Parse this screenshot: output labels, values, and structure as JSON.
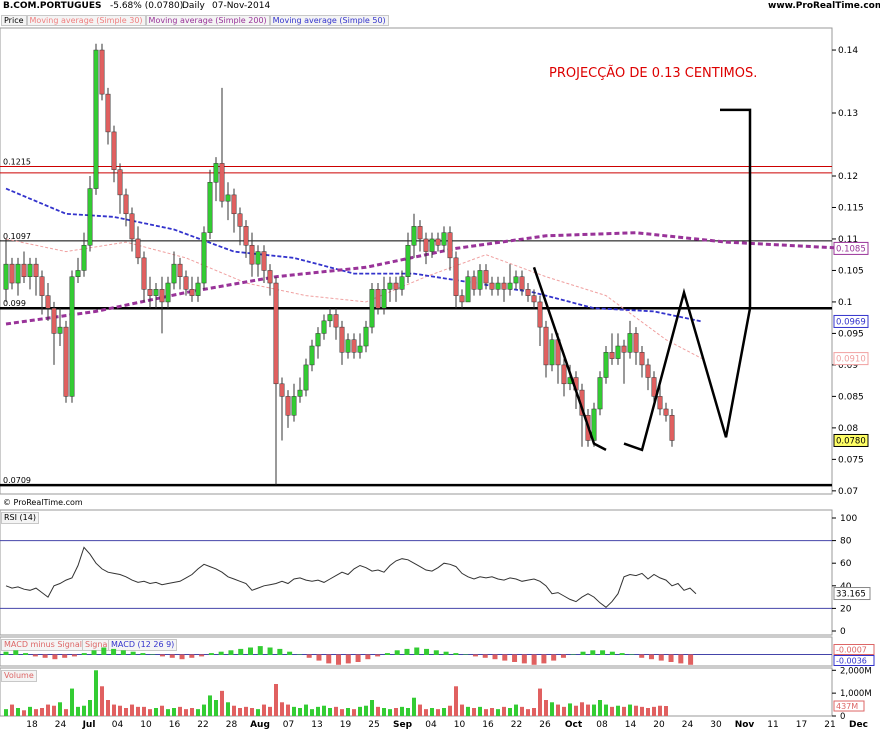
{
  "header": {
    "symbol": "B.COM.PORTUGUES",
    "change": "-5.68% (0.0780)",
    "period": "Daily",
    "date": "07-Nov-2014",
    "site": "www.ProRealTime.com"
  },
  "legend": {
    "price": "Price",
    "ma30": "Moving average (Simple 30)",
    "ma200": "Moving average (Simple 200)",
    "ma50": "Moving average (Simple 50)"
  },
  "copyright": "© ProRealTime.com",
  "annotation": "PROJECÇÃO DE 0.13 CENTIMOS.",
  "colors": {
    "up": "#33cc33",
    "down": "#e06060",
    "ma200": "#993399",
    "ma50": "#3333cc",
    "ma30": "#f0a0a0",
    "hline_red": "#cc0000",
    "annotation": "#dd0000"
  },
  "chart_data": [
    {
      "type": "candlestick",
      "title": "Price",
      "ylim": [
        0.0695,
        0.1435
      ],
      "y_ticks": [
        "0.14",
        "0.13",
        "0.12",
        "0.115",
        "0.11",
        "0.105",
        "0.1",
        "0.095",
        "0.09",
        "0.085",
        "0.08",
        "0.075",
        "0.07"
      ],
      "x_ticks": [
        "18",
        "24",
        "Jul",
        "04",
        "10",
        "16",
        "22",
        "28",
        "Aug",
        "07",
        "13",
        "19",
        "25",
        "Sep",
        "04",
        "10",
        "16",
        "22",
        "26",
        "Oct",
        "08",
        "14",
        "20",
        "24",
        "30",
        "Nov",
        "11",
        "17",
        "21",
        "Dec"
      ],
      "hlines": [
        {
          "value": 0.1215,
          "label": "0.1215",
          "color": "red"
        },
        {
          "value": 0.1205,
          "label": "",
          "color": "red"
        },
        {
          "value": 0.1097,
          "label": "0.1097",
          "color": "black"
        },
        {
          "value": 0.099,
          "label": "0.099",
          "color": "black"
        },
        {
          "value": 0.0709,
          "label": "0.0709",
          "color": "black"
        }
      ],
      "value_tags": [
        {
          "value": 0.1085,
          "label": "0.1085",
          "series": "Moving average (Simple 200)"
        },
        {
          "value": 0.0969,
          "label": "0.0969",
          "series": "Moving average (Simple 50)"
        },
        {
          "value": 0.091,
          "label": "0.0910",
          "series": "Moving average (Simple 30)"
        },
        {
          "value": 0.078,
          "label": "0.0780",
          "series": "Price"
        }
      ],
      "candles": [
        [
          0.102,
          0.106,
          0.11,
          0.1
        ],
        [
          0.106,
          0.103,
          0.107,
          0.102
        ],
        [
          0.103,
          0.106,
          0.107,
          0.101
        ],
        [
          0.106,
          0.104,
          0.108,
          0.103
        ],
        [
          0.104,
          0.106,
          0.107,
          0.102
        ],
        [
          0.106,
          0.104,
          0.107,
          0.101
        ],
        [
          0.104,
          0.101,
          0.105,
          0.098
        ],
        [
          0.101,
          0.099,
          0.103,
          0.097
        ],
        [
          0.099,
          0.095,
          0.1,
          0.09
        ],
        [
          0.095,
          0.096,
          0.099,
          0.093
        ],
        [
          0.096,
          0.085,
          0.097,
          0.084
        ],
        [
          0.085,
          0.104,
          0.105,
          0.084
        ],
        [
          0.104,
          0.105,
          0.107,
          0.103
        ],
        [
          0.105,
          0.109,
          0.111,
          0.104
        ],
        [
          0.109,
          0.118,
          0.12,
          0.108
        ],
        [
          0.118,
          0.14,
          0.141,
          0.117
        ],
        [
          0.14,
          0.133,
          0.141,
          0.132
        ],
        [
          0.133,
          0.127,
          0.134,
          0.125
        ],
        [
          0.127,
          0.121,
          0.128,
          0.119
        ],
        [
          0.121,
          0.117,
          0.122,
          0.114
        ],
        [
          0.117,
          0.114,
          0.118,
          0.112
        ],
        [
          0.114,
          0.11,
          0.115,
          0.108
        ],
        [
          0.11,
          0.107,
          0.112,
          0.106
        ],
        [
          0.107,
          0.102,
          0.108,
          0.1
        ],
        [
          0.102,
          0.101,
          0.104,
          0.099
        ],
        [
          0.101,
          0.102,
          0.103,
          0.099
        ],
        [
          0.102,
          0.1,
          0.104,
          0.095
        ],
        [
          0.1,
          0.103,
          0.104,
          0.099
        ],
        [
          0.103,
          0.106,
          0.108,
          0.102
        ],
        [
          0.106,
          0.104,
          0.107,
          0.102
        ],
        [
          0.104,
          0.102,
          0.105,
          0.101
        ],
        [
          0.102,
          0.101,
          0.104,
          0.1
        ],
        [
          0.101,
          0.103,
          0.104,
          0.1
        ],
        [
          0.103,
          0.111,
          0.112,
          0.102
        ],
        [
          0.111,
          0.119,
          0.121,
          0.11
        ],
        [
          0.119,
          0.122,
          0.123,
          0.116
        ],
        [
          0.122,
          0.116,
          0.134,
          0.115
        ],
        [
          0.116,
          0.117,
          0.119,
          0.113
        ],
        [
          0.117,
          0.114,
          0.118,
          0.111
        ],
        [
          0.114,
          0.112,
          0.115,
          0.109
        ],
        [
          0.112,
          0.109,
          0.113,
          0.107
        ],
        [
          0.109,
          0.106,
          0.111,
          0.104
        ],
        [
          0.106,
          0.108,
          0.109,
          0.104
        ],
        [
          0.108,
          0.105,
          0.109,
          0.103
        ],
        [
          0.105,
          0.103,
          0.106,
          0.101
        ],
        [
          0.103,
          0.087,
          0.104,
          0.071
        ],
        [
          0.087,
          0.085,
          0.088,
          0.078
        ],
        [
          0.085,
          0.082,
          0.086,
          0.08
        ],
        [
          0.082,
          0.085,
          0.087,
          0.081
        ],
        [
          0.085,
          0.086,
          0.088,
          0.084
        ],
        [
          0.086,
          0.09,
          0.091,
          0.085
        ],
        [
          0.09,
          0.093,
          0.094,
          0.089
        ],
        [
          0.093,
          0.095,
          0.096,
          0.091
        ],
        [
          0.095,
          0.097,
          0.098,
          0.094
        ],
        [
          0.097,
          0.098,
          0.099,
          0.096
        ],
        [
          0.098,
          0.096,
          0.099,
          0.094
        ],
        [
          0.096,
          0.092,
          0.097,
          0.09
        ],
        [
          0.092,
          0.094,
          0.095,
          0.091
        ],
        [
          0.094,
          0.092,
          0.095,
          0.091
        ],
        [
          0.092,
          0.093,
          0.095,
          0.091
        ],
        [
          0.093,
          0.096,
          0.097,
          0.092
        ],
        [
          0.096,
          0.102,
          0.103,
          0.095
        ],
        [
          0.102,
          0.099,
          0.103,
          0.098
        ],
        [
          0.099,
          0.102,
          0.104,
          0.098
        ],
        [
          0.102,
          0.103,
          0.104,
          0.1
        ],
        [
          0.103,
          0.102,
          0.104,
          0.1
        ],
        [
          0.102,
          0.104,
          0.105,
          0.101
        ],
        [
          0.104,
          0.109,
          0.111,
          0.103
        ],
        [
          0.109,
          0.112,
          0.114,
          0.107
        ],
        [
          0.112,
          0.11,
          0.113,
          0.108
        ],
        [
          0.11,
          0.108,
          0.111,
          0.106
        ],
        [
          0.108,
          0.11,
          0.111,
          0.107
        ],
        [
          0.11,
          0.109,
          0.111,
          0.108
        ],
        [
          0.109,
          0.111,
          0.112,
          0.108
        ],
        [
          0.111,
          0.107,
          0.112,
          0.105
        ],
        [
          0.107,
          0.101,
          0.108,
          0.099
        ],
        [
          0.101,
          0.1,
          0.102,
          0.099
        ],
        [
          0.1,
          0.104,
          0.105,
          0.1
        ],
        [
          0.104,
          0.102,
          0.105,
          0.101
        ],
        [
          0.102,
          0.105,
          0.106,
          0.101
        ],
        [
          0.105,
          0.103,
          0.106,
          0.102
        ],
        [
          0.103,
          0.102,
          0.104,
          0.101
        ],
        [
          0.102,
          0.103,
          0.104,
          0.101
        ],
        [
          0.103,
          0.102,
          0.104,
          0.1
        ],
        [
          0.102,
          0.103,
          0.106,
          0.101
        ],
        [
          0.103,
          0.104,
          0.105,
          0.102
        ],
        [
          0.104,
          0.102,
          0.105,
          0.101
        ],
        [
          0.102,
          0.101,
          0.103,
          0.1
        ],
        [
          0.101,
          0.1,
          0.102,
          0.099
        ],
        [
          0.1,
          0.096,
          0.101,
          0.093
        ],
        [
          0.096,
          0.09,
          0.097,
          0.088
        ],
        [
          0.09,
          0.094,
          0.095,
          0.089
        ],
        [
          0.094,
          0.09,
          0.095,
          0.087
        ],
        [
          0.09,
          0.087,
          0.091,
          0.085
        ],
        [
          0.087,
          0.088,
          0.09,
          0.086
        ],
        [
          0.088,
          0.086,
          0.089,
          0.083
        ],
        [
          0.086,
          0.082,
          0.087,
          0.077
        ],
        [
          0.082,
          0.078,
          0.083,
          0.077
        ],
        [
          0.078,
          0.083,
          0.084,
          0.077
        ],
        [
          0.083,
          0.088,
          0.089,
          0.082
        ],
        [
          0.088,
          0.092,
          0.093,
          0.087
        ],
        [
          0.092,
          0.091,
          0.095,
          0.09
        ],
        [
          0.091,
          0.093,
          0.095,
          0.09
        ],
        [
          0.093,
          0.092,
          0.094,
          0.087
        ],
        [
          0.092,
          0.095,
          0.097,
          0.091
        ],
        [
          0.095,
          0.092,
          0.096,
          0.09
        ],
        [
          0.092,
          0.09,
          0.093,
          0.088
        ],
        [
          0.09,
          0.088,
          0.091,
          0.086
        ],
        [
          0.088,
          0.085,
          0.089,
          0.084
        ],
        [
          0.085,
          0.083,
          0.087,
          0.082
        ],
        [
          0.083,
          0.082,
          0.084,
          0.081
        ],
        [
          0.082,
          0.078,
          0.083,
          0.077
        ]
      ],
      "ma200": [
        [
          0,
          0.0965
        ],
        [
          15,
          0.0985
        ],
        [
          30,
          0.1015
        ],
        [
          45,
          0.104
        ],
        [
          60,
          0.1055
        ],
        [
          75,
          0.1085
        ],
        [
          90,
          0.1105
        ],
        [
          105,
          0.111
        ],
        [
          120,
          0.1095
        ],
        [
          140,
          0.1085
        ]
      ],
      "ma50": [
        [
          0,
          0.118
        ],
        [
          10,
          0.114
        ],
        [
          18,
          0.1135
        ],
        [
          28,
          0.1115
        ],
        [
          38,
          0.108
        ],
        [
          48,
          0.107
        ],
        [
          58,
          0.1045
        ],
        [
          68,
          0.1045
        ],
        [
          78,
          0.103
        ],
        [
          88,
          0.1015
        ],
        [
          98,
          0.099
        ],
        [
          108,
          0.0985
        ],
        [
          116,
          0.0969
        ]
      ],
      "ma30": [
        [
          0,
          0.11
        ],
        [
          10,
          0.108
        ],
        [
          20,
          0.1095
        ],
        [
          30,
          0.107
        ],
        [
          40,
          0.103
        ],
        [
          50,
          0.101
        ],
        [
          60,
          0.1
        ],
        [
          70,
          0.104
        ],
        [
          80,
          0.1075
        ],
        [
          90,
          0.104
        ],
        [
          100,
          0.101
        ],
        [
          110,
          0.094
        ],
        [
          116,
          0.091
        ]
      ],
      "pattern": [
        [
          103,
          0.0775
        ],
        [
          106,
          0.0765
        ],
        [
          113,
          0.1015
        ],
        [
          120,
          0.0785
        ],
        [
          124,
          0.099
        ],
        [
          124,
          0.1305
        ],
        [
          119,
          0.1305
        ]
      ]
    },
    {
      "type": "line",
      "title": "RSI (14)",
      "ylim": [
        0,
        100
      ],
      "y_ticks": [
        "100",
        "80",
        "60",
        "40",
        "20",
        "0"
      ],
      "hlines": [
        {
          "value": 80
        },
        {
          "value": 20
        }
      ],
      "value_tags": [
        {
          "value": 33.165,
          "label": "33.165"
        }
      ],
      "values": [
        40,
        38,
        39,
        37,
        36,
        38,
        34,
        30,
        40,
        42,
        45,
        47,
        58,
        74,
        68,
        60,
        55,
        52,
        51,
        50,
        48,
        45,
        43,
        44,
        42,
        43,
        41,
        42,
        43,
        44,
        47,
        50,
        55,
        59,
        57,
        55,
        52,
        48,
        46,
        44,
        42,
        36,
        38,
        40,
        41,
        42,
        44,
        42,
        46,
        47,
        45,
        44,
        45,
        43,
        46,
        49,
        52,
        50,
        55,
        58,
        56,
        53,
        54,
        52,
        58,
        62,
        64,
        63,
        60,
        57,
        54,
        53,
        56,
        60,
        59,
        57,
        51,
        48,
        46,
        48,
        47,
        48,
        46,
        45,
        47,
        46,
        44,
        45,
        46,
        44,
        40,
        33,
        34,
        31,
        28,
        26,
        30,
        33,
        30,
        25,
        21,
        26,
        33,
        48,
        50,
        49,
        51,
        46,
        50,
        47,
        45,
        40,
        42,
        36,
        38,
        33
      ],
      "legend": "RSI (14)"
    },
    {
      "type": "bar",
      "title": "MACD (12 26 9)",
      "series_labels": [
        "MACD minus Signal",
        "Signal",
        "MACD (12 26 9)"
      ],
      "value_tags": [
        {
          "value": -0.0007,
          "label": "-0.0007"
        },
        {
          "value": -0.0036,
          "label": "-0.0036"
        }
      ],
      "histogram": [
        0.0002,
        0.0003,
        0.0001,
        -0.0001,
        -0.0002,
        -0.0003,
        -0.0002,
        -0.0001,
        0.0001,
        0.0003,
        0.0005,
        0.0004,
        0.0003,
        0.0002,
        0.0001,
        0.0,
        -0.0001,
        -0.0002,
        -0.0003,
        -0.0002,
        -0.0001,
        0.0001,
        0.0002,
        0.0003,
        0.0004,
        0.0005,
        0.0006,
        0.0005,
        0.0004,
        0.0002,
        0.0,
        -0.0002,
        -0.0004,
        -0.0006,
        -0.0007,
        -0.0006,
        -0.0005,
        -0.0003,
        -0.0001,
        0.0001,
        0.0003,
        0.0004,
        0.0005,
        0.0004,
        0.0003,
        0.0002,
        0.0001,
        0.0,
        -0.0001,
        -0.0002,
        -0.0003,
        -0.0004,
        -0.0005,
        -0.0006,
        -0.0007,
        -0.0006,
        -0.0004,
        -0.0002,
        0.0,
        0.0002,
        0.0003,
        0.0003,
        0.0002,
        0.0001,
        0.0,
        -0.0002,
        -0.0003,
        -0.0004,
        -0.0005,
        -0.0006,
        -0.0007
      ],
      "legend": "MACD (12 26 9)"
    },
    {
      "type": "bar",
      "title": "Volume",
      "y_ticks": [
        "2,000M",
        "1,000M",
        "0"
      ],
      "value_tags": [
        {
          "value": 437,
          "label": "437M"
        }
      ],
      "ylim": [
        0,
        2100
      ],
      "values": [
        300,
        500,
        350,
        250,
        400,
        300,
        350,
        500,
        450,
        600,
        300,
        1200,
        400,
        450,
        700,
        2000,
        1300,
        700,
        500,
        450,
        350,
        500,
        400,
        400,
        300,
        350,
        450,
        300,
        350,
        400,
        300,
        350,
        300,
        500,
        900,
        700,
        1100,
        600,
        450,
        350,
        400,
        350,
        300,
        500,
        400,
        1400,
        600,
        500,
        400,
        350,
        500,
        300,
        400,
        450,
        350,
        400,
        300,
        350,
        300,
        400,
        450,
        700,
        400,
        350,
        300,
        350,
        400,
        350,
        800,
        500,
        300,
        350,
        300,
        350,
        450,
        1300,
        500,
        400,
        350,
        400,
        300,
        350,
        300,
        400,
        350,
        500,
        400,
        300,
        350,
        1200,
        700,
        600,
        500,
        400,
        550,
        450,
        600,
        500,
        500,
        700,
        500,
        400,
        450,
        400,
        500,
        450,
        400,
        350,
        400,
        450,
        437
      ]
    }
  ]
}
